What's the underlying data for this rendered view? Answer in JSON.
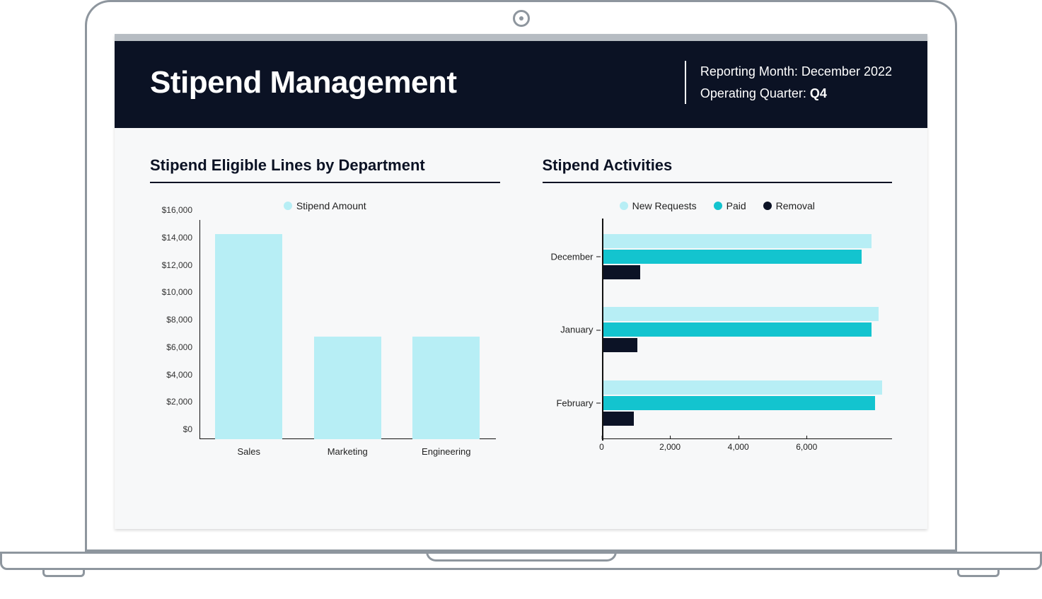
{
  "header": {
    "title": "Stipend Management",
    "reporting_label": "Reporting Month:",
    "reporting_value": "December 2022",
    "quarter_label": "Operating Quarter:",
    "quarter_value": "Q4"
  },
  "panel_left": {
    "title": "Stipend Eligible Lines by Department",
    "legend": [
      {
        "name": "Stipend Amount",
        "color": "#b7eef5"
      }
    ]
  },
  "panel_right": {
    "title": "Stipend Activities",
    "legend": [
      {
        "name": "New Requests",
        "color": "#b7eef5"
      },
      {
        "name": "Paid",
        "color": "#13c4cf"
      },
      {
        "name": "Removal",
        "color": "#0c1326"
      }
    ]
  },
  "colors": {
    "light_cyan": "#b7eef5",
    "teal": "#13c4cf",
    "navy": "#0c1326"
  },
  "chart_data": [
    {
      "id": "eligible_lines",
      "type": "bar",
      "orientation": "vertical",
      "title": "Stipend Eligible Lines by Department",
      "xlabel": "",
      "ylabel": "",
      "categories": [
        "Sales",
        "Marketing",
        "Engineering"
      ],
      "series": [
        {
          "name": "Stipend Amount",
          "color": "#b7eef5",
          "values": [
            15000,
            7500,
            7500
          ]
        }
      ],
      "ylim": [
        0,
        16000
      ],
      "yticks": [
        0,
        2000,
        4000,
        6000,
        8000,
        10000,
        12000,
        14000,
        16000
      ],
      "ytick_labels": [
        "$0",
        "$2,000",
        "$4,000",
        "$6,000",
        "$8,000",
        "$10,000",
        "$12,000",
        "$14,000",
        "$16,000"
      ]
    },
    {
      "id": "activities",
      "type": "bar",
      "orientation": "horizontal",
      "title": "Stipend Activities",
      "categories": [
        "December",
        "January",
        "February"
      ],
      "series": [
        {
          "name": "New Requests",
          "color": "#b7eef5",
          "values": [
            7900,
            8100,
            8200
          ]
        },
        {
          "name": "Paid",
          "color": "#13c4cf",
          "values": [
            7600,
            7900,
            8000
          ]
        },
        {
          "name": "Removal",
          "color": "#0c1326",
          "values": [
            1100,
            1000,
            900
          ]
        }
      ],
      "xlim": [
        0,
        8500
      ],
      "xticks": [
        0,
        2000,
        4000,
        6000
      ],
      "xtick_labels": [
        "0",
        "2,000",
        "4,000",
        "6,000"
      ]
    }
  ]
}
